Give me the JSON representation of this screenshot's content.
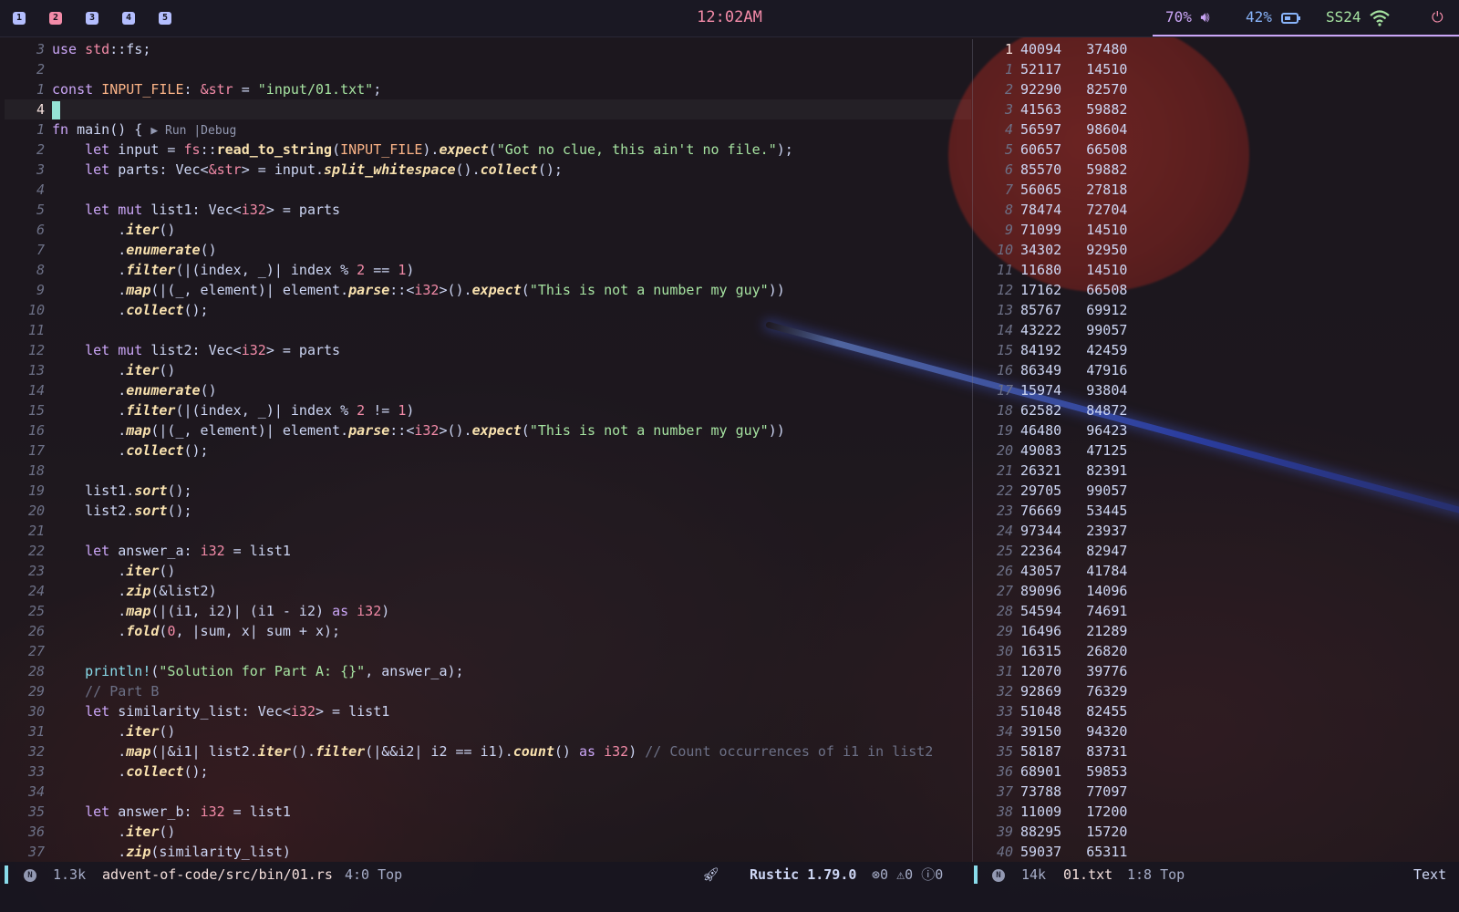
{
  "topbar": {
    "workspaces": [
      "1",
      "2",
      "3",
      "4",
      "5"
    ],
    "active_workspace": "2",
    "clock": "12:02AM",
    "volume": "70%",
    "battery": "42%",
    "network": "SS24"
  },
  "editor": {
    "lines": [
      {
        "n": "3",
        "t": [
          [
            "kw",
            "use "
          ],
          [
            "ty",
            "std"
          ],
          [
            "pl",
            "::fs;"
          ]
        ]
      },
      {
        "n": "2",
        "t": []
      },
      {
        "n": "1",
        "t": [
          [
            "kw",
            "const "
          ],
          [
            "fn2",
            "INPUT_FILE"
          ],
          [
            "pl",
            ": "
          ],
          [
            "ty",
            "&str"
          ],
          [
            "pl",
            " = "
          ],
          [
            "st2",
            "\"input/01.txt\""
          ],
          [
            "pl",
            ";"
          ]
        ]
      },
      {
        "n": "4",
        "cur": true,
        "t": []
      },
      {
        "n": "1",
        "t": [
          [
            "kw",
            "fn "
          ],
          [
            "pl",
            "main() { "
          ],
          [
            "hint",
            "▶ Run |Debug"
          ]
        ]
      },
      {
        "n": "2",
        "t": [
          [
            "pl",
            "    "
          ],
          [
            "kw",
            "let "
          ],
          [
            "pl",
            "input = "
          ],
          [
            "ty",
            "fs"
          ],
          [
            "pl",
            "::"
          ],
          [
            "fnb",
            "read_to_string"
          ],
          [
            "pl",
            "("
          ],
          [
            "fn2",
            "INPUT_FILE"
          ],
          [
            "pl",
            ")."
          ],
          [
            "fn",
            "expect"
          ],
          [
            "pl",
            "("
          ],
          [
            "st2",
            "\"Got no clue, this ain't no file.\""
          ],
          [
            "pl",
            ");"
          ]
        ]
      },
      {
        "n": "3",
        "t": [
          [
            "pl",
            "    "
          ],
          [
            "kw",
            "let "
          ],
          [
            "pl",
            "parts: Vec<"
          ],
          [
            "ty",
            "&str"
          ],
          [
            "pl",
            "> = input."
          ],
          [
            "fn",
            "split_whitespace"
          ],
          [
            "pl",
            "()."
          ],
          [
            "fn",
            "collect"
          ],
          [
            "pl",
            "();"
          ]
        ]
      },
      {
        "n": "4",
        "t": []
      },
      {
        "n": "5",
        "t": [
          [
            "pl",
            "    "
          ],
          [
            "kw",
            "let mut "
          ],
          [
            "pl",
            "list1: Vec<"
          ],
          [
            "ty",
            "i32"
          ],
          [
            "pl",
            "> = parts"
          ]
        ]
      },
      {
        "n": "6",
        "t": [
          [
            "pl",
            "        ."
          ],
          [
            "fn",
            "iter"
          ],
          [
            "pl",
            "()"
          ]
        ]
      },
      {
        "n": "7",
        "t": [
          [
            "pl",
            "        ."
          ],
          [
            "fn",
            "enumerate"
          ],
          [
            "pl",
            "()"
          ]
        ]
      },
      {
        "n": "8",
        "t": [
          [
            "pl",
            "        ."
          ],
          [
            "fn",
            "filter"
          ],
          [
            "pl",
            "(|(index, _)| index % "
          ],
          [
            "ty",
            "2"
          ],
          [
            "pl",
            " == "
          ],
          [
            "ty",
            "1"
          ],
          [
            "pl",
            ")"
          ]
        ]
      },
      {
        "n": "9",
        "t": [
          [
            "pl",
            "        ."
          ],
          [
            "fn",
            "map"
          ],
          [
            "pl",
            "(|(_, element)| element."
          ],
          [
            "fn",
            "parse"
          ],
          [
            "pl",
            "::<"
          ],
          [
            "ty",
            "i32"
          ],
          [
            "pl",
            ">()."
          ],
          [
            "fn",
            "expect"
          ],
          [
            "pl",
            "("
          ],
          [
            "st2",
            "\"This is not a number my guy\""
          ],
          [
            "pl",
            "))"
          ]
        ]
      },
      {
        "n": "10",
        "t": [
          [
            "pl",
            "        ."
          ],
          [
            "fn",
            "collect"
          ],
          [
            "pl",
            "();"
          ]
        ]
      },
      {
        "n": "11",
        "t": []
      },
      {
        "n": "12",
        "t": [
          [
            "pl",
            "    "
          ],
          [
            "kw",
            "let mut "
          ],
          [
            "pl",
            "list2: Vec<"
          ],
          [
            "ty",
            "i32"
          ],
          [
            "pl",
            "> = parts"
          ]
        ]
      },
      {
        "n": "13",
        "t": [
          [
            "pl",
            "        ."
          ],
          [
            "fn",
            "iter"
          ],
          [
            "pl",
            "()"
          ]
        ]
      },
      {
        "n": "14",
        "t": [
          [
            "pl",
            "        ."
          ],
          [
            "fn",
            "enumerate"
          ],
          [
            "pl",
            "()"
          ]
        ]
      },
      {
        "n": "15",
        "t": [
          [
            "pl",
            "        ."
          ],
          [
            "fn",
            "filter"
          ],
          [
            "pl",
            "(|(index, _)| index % "
          ],
          [
            "ty",
            "2"
          ],
          [
            "pl",
            " != "
          ],
          [
            "ty",
            "1"
          ],
          [
            "pl",
            ")"
          ]
        ]
      },
      {
        "n": "16",
        "t": [
          [
            "pl",
            "        ."
          ],
          [
            "fn",
            "map"
          ],
          [
            "pl",
            "(|(_, element)| element."
          ],
          [
            "fn",
            "parse"
          ],
          [
            "pl",
            "::<"
          ],
          [
            "ty",
            "i32"
          ],
          [
            "pl",
            ">()."
          ],
          [
            "fn",
            "expect"
          ],
          [
            "pl",
            "("
          ],
          [
            "st2",
            "\"This is not a number my guy\""
          ],
          [
            "pl",
            "))"
          ]
        ]
      },
      {
        "n": "17",
        "t": [
          [
            "pl",
            "        ."
          ],
          [
            "fn",
            "collect"
          ],
          [
            "pl",
            "();"
          ]
        ]
      },
      {
        "n": "18",
        "t": []
      },
      {
        "n": "19",
        "t": [
          [
            "pl",
            "    list1."
          ],
          [
            "fn",
            "sort"
          ],
          [
            "pl",
            "();"
          ]
        ]
      },
      {
        "n": "20",
        "t": [
          [
            "pl",
            "    list2."
          ],
          [
            "fn",
            "sort"
          ],
          [
            "pl",
            "();"
          ]
        ]
      },
      {
        "n": "21",
        "t": []
      },
      {
        "n": "22",
        "t": [
          [
            "pl",
            "    "
          ],
          [
            "kw",
            "let "
          ],
          [
            "pl",
            "answer_a: "
          ],
          [
            "ty",
            "i32"
          ],
          [
            "pl",
            " = list1"
          ]
        ]
      },
      {
        "n": "23",
        "t": [
          [
            "pl",
            "        ."
          ],
          [
            "fn",
            "iter"
          ],
          [
            "pl",
            "()"
          ]
        ]
      },
      {
        "n": "24",
        "t": [
          [
            "pl",
            "        ."
          ],
          [
            "fn",
            "zip"
          ],
          [
            "pl",
            "(&list2)"
          ]
        ]
      },
      {
        "n": "25",
        "t": [
          [
            "pl",
            "        ."
          ],
          [
            "fn",
            "map"
          ],
          [
            "pl",
            "(|(i1, i2)| (i1 - i2) "
          ],
          [
            "kw",
            "as "
          ],
          [
            "ty",
            "i32"
          ],
          [
            "pl",
            ")"
          ]
        ]
      },
      {
        "n": "26",
        "t": [
          [
            "pl",
            "        ."
          ],
          [
            "fn",
            "fold"
          ],
          [
            "pl",
            "("
          ],
          [
            "ty",
            "0"
          ],
          [
            "pl",
            ", |sum, x| sum + x);"
          ]
        ]
      },
      {
        "n": "27",
        "t": []
      },
      {
        "n": "28",
        "t": [
          [
            "pl",
            "    "
          ],
          [
            "mc",
            "println!"
          ],
          [
            "pl",
            "("
          ],
          [
            "st2",
            "\"Solution for Part A: {}\""
          ],
          [
            "pl",
            ", answer_a);"
          ]
        ]
      },
      {
        "n": "29",
        "t": [
          [
            "pl",
            "    "
          ],
          [
            "cm",
            "// Part B"
          ]
        ]
      },
      {
        "n": "30",
        "t": [
          [
            "pl",
            "    "
          ],
          [
            "kw",
            "let "
          ],
          [
            "pl",
            "similarity_list: Vec<"
          ],
          [
            "ty",
            "i32"
          ],
          [
            "pl",
            "> = list1"
          ]
        ]
      },
      {
        "n": "31",
        "t": [
          [
            "pl",
            "        ."
          ],
          [
            "fn",
            "iter"
          ],
          [
            "pl",
            "()"
          ]
        ]
      },
      {
        "n": "32",
        "t": [
          [
            "pl",
            "        ."
          ],
          [
            "fn",
            "map"
          ],
          [
            "pl",
            "(|&i1| list2."
          ],
          [
            "fn",
            "iter"
          ],
          [
            "pl",
            "()."
          ],
          [
            "fn",
            "filter"
          ],
          [
            "pl",
            "(|&&i2| i2 == i1)."
          ],
          [
            "fn",
            "count"
          ],
          [
            "pl",
            "() "
          ],
          [
            "kw",
            "as "
          ],
          [
            "ty",
            "i32"
          ],
          [
            "pl",
            ") "
          ],
          [
            "cm",
            "// Count occurrences of i1 in list2"
          ]
        ]
      },
      {
        "n": "33",
        "t": [
          [
            "pl",
            "        ."
          ],
          [
            "fn",
            "collect"
          ],
          [
            "pl",
            "();"
          ]
        ]
      },
      {
        "n": "34",
        "t": []
      },
      {
        "n": "35",
        "t": [
          [
            "pl",
            "    "
          ],
          [
            "kw",
            "let "
          ],
          [
            "pl",
            "answer_b: "
          ],
          [
            "ty",
            "i32"
          ],
          [
            "pl",
            " = list1"
          ]
        ]
      },
      {
        "n": "36",
        "t": [
          [
            "pl",
            "        ."
          ],
          [
            "fn",
            "iter"
          ],
          [
            "pl",
            "()"
          ]
        ]
      },
      {
        "n": "37",
        "t": [
          [
            "pl",
            "        ."
          ],
          [
            "fn",
            "zip"
          ],
          [
            "pl",
            "(similarity_list)"
          ]
        ]
      }
    ]
  },
  "data_pane": {
    "rows": [
      [
        "1",
        "40094",
        "37480"
      ],
      [
        "1",
        "52117",
        "14510"
      ],
      [
        "2",
        "92290",
        "82570"
      ],
      [
        "3",
        "41563",
        "59882"
      ],
      [
        "4",
        "56597",
        "98604"
      ],
      [
        "5",
        "60657",
        "66508"
      ],
      [
        "6",
        "85570",
        "59882"
      ],
      [
        "7",
        "56065",
        "27818"
      ],
      [
        "8",
        "78474",
        "72704"
      ],
      [
        "9",
        "71099",
        "14510"
      ],
      [
        "10",
        "34302",
        "92950"
      ],
      [
        "11",
        "11680",
        "14510"
      ],
      [
        "12",
        "17162",
        "66508"
      ],
      [
        "13",
        "85767",
        "69912"
      ],
      [
        "14",
        "43222",
        "99057"
      ],
      [
        "15",
        "84192",
        "42459"
      ],
      [
        "16",
        "86349",
        "47916"
      ],
      [
        "17",
        "15974",
        "93804"
      ],
      [
        "18",
        "62582",
        "84872"
      ],
      [
        "19",
        "46480",
        "96423"
      ],
      [
        "20",
        "49083",
        "47125"
      ],
      [
        "21",
        "26321",
        "82391"
      ],
      [
        "22",
        "29705",
        "99057"
      ],
      [
        "23",
        "76669",
        "53445"
      ],
      [
        "24",
        "97344",
        "23937"
      ],
      [
        "25",
        "22364",
        "82947"
      ],
      [
        "26",
        "43057",
        "41784"
      ],
      [
        "27",
        "89096",
        "14096"
      ],
      [
        "28",
        "54594",
        "74691"
      ],
      [
        "29",
        "16496",
        "21289"
      ],
      [
        "30",
        "16315",
        "26820"
      ],
      [
        "31",
        "12070",
        "39776"
      ],
      [
        "32",
        "92869",
        "76329"
      ],
      [
        "33",
        "51048",
        "82455"
      ],
      [
        "34",
        "39150",
        "94320"
      ],
      [
        "35",
        "58187",
        "83731"
      ],
      [
        "36",
        "68901",
        "59853"
      ],
      [
        "37",
        "73788",
        "77097"
      ],
      [
        "38",
        "11009",
        "17200"
      ],
      [
        "39",
        "88295",
        "15720"
      ],
      [
        "40",
        "59037",
        "65311"
      ]
    ]
  },
  "statusline": {
    "left_mode": "N",
    "left_size": "1.3k",
    "left_file": "advent-of-code/src/bin/01.rs",
    "left_pos": "4:0 Top",
    "lsp": "Rustic 1.79.0",
    "errors": "0",
    "warnings": "0",
    "infos": "0",
    "right_mode": "N",
    "right_size": "14k",
    "right_file": "01.txt",
    "right_pos": "1:8 Top",
    "right_type": "Text"
  }
}
